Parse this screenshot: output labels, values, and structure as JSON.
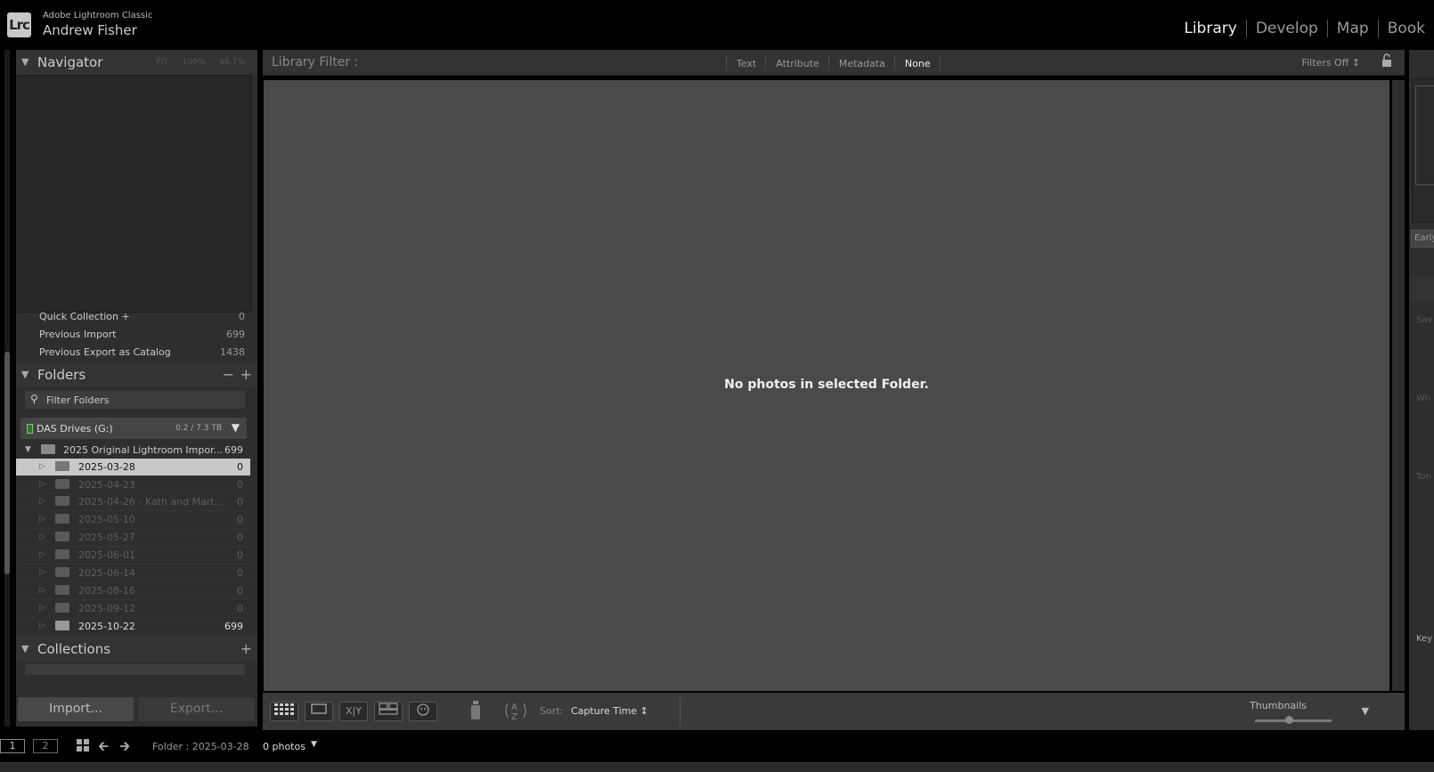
{
  "app": {
    "name": "Adobe Lightroom Classic",
    "user": "Andrew Fisher",
    "logo": "Lrc"
  },
  "modules": [
    "Library",
    "Develop",
    "Map",
    "Book"
  ],
  "navigator": {
    "title": "Navigator",
    "options": [
      "FIT",
      "100%",
      "66.7%"
    ]
  },
  "catalog": [
    {
      "label": "Quick Collection +",
      "count": "0"
    },
    {
      "label": "Previous Import",
      "count": "699"
    },
    {
      "label": "Previous Export as Catalog",
      "count": "1438"
    }
  ],
  "folders": {
    "title": "Folders",
    "filter_placeholder": "Filter Folders",
    "volume": {
      "name": "DAS Drives (G:)",
      "size": "0.2 / 7.3 TB"
    },
    "root": {
      "name": "2025 Original Lightroom Impor...",
      "count": "699"
    },
    "items": [
      {
        "name": "2025-03-28",
        "count": "0"
      },
      {
        "name": "2025-04-23",
        "count": "0"
      },
      {
        "name": "2025-04-26 - Kath and Mart...",
        "count": "0"
      },
      {
        "name": "2025-05-10",
        "count": "0"
      },
      {
        "name": "2025-05-27",
        "count": "0"
      },
      {
        "name": "2025-06-01",
        "count": "0"
      },
      {
        "name": "2025-06-14",
        "count": "0"
      },
      {
        "name": "2025-08-16",
        "count": "0"
      },
      {
        "name": "2025-09-12",
        "count": "0"
      },
      {
        "name": "2025-10-22",
        "count": "699"
      }
    ]
  },
  "collections": {
    "title": "Collections"
  },
  "buttons": {
    "import": "Import...",
    "export": "Export..."
  },
  "filter_bar": {
    "title": "Library Filter :",
    "tabs": [
      "Text",
      "Attribute",
      "Metadata",
      "None"
    ],
    "active": "None",
    "status": "Filters Off ↕"
  },
  "grid": {
    "empty_message": "No photos in selected Folder."
  },
  "toolbar": {
    "compare_label": "X|Y",
    "sort_label": "Sort:",
    "sort_value": "Capture Time ↕",
    "thumbnails_label": "Thumbnails"
  },
  "right_panel": {
    "labels": [
      "Early",
      "Sav",
      "Wh",
      "Ton",
      "Key"
    ]
  },
  "bottom": {
    "screen1": "1",
    "screen2": "2",
    "folder_path": "Folder : 2025-03-28",
    "photo_count": "0 photos"
  },
  "icons": {
    "search": "search-icon",
    "lock": "lock-icon",
    "grid": "grid-icon",
    "painter": "painter-icon"
  },
  "colors": {
    "background": "#4a4a4a",
    "panel": "#2e2e2e",
    "selected_row": "#c8c8c8",
    "volume_led": "#7c7"
  }
}
